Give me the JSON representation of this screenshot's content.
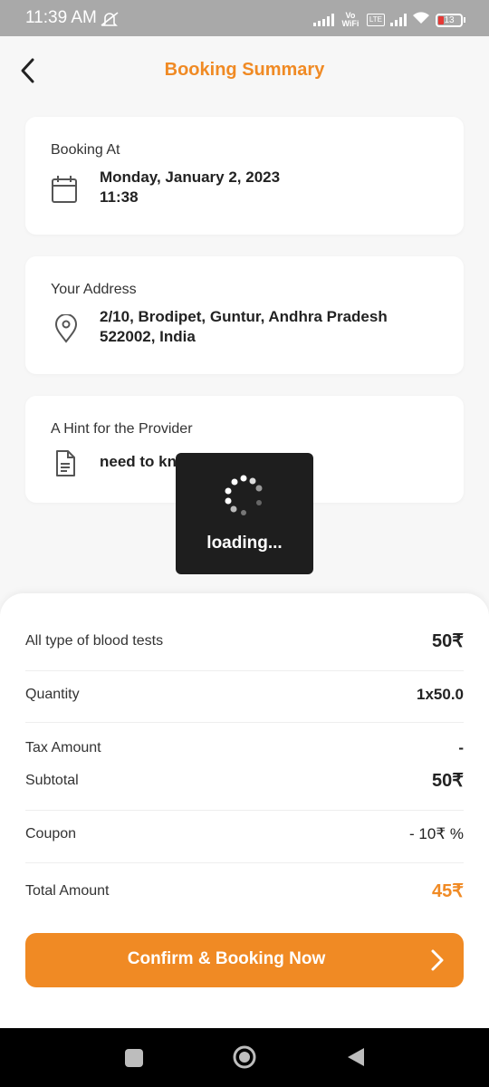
{
  "status_bar": {
    "time": "11:39 AM",
    "vo_wifi": "Vo WiFi",
    "volte": "Vo LTE",
    "battery": "13"
  },
  "header": {
    "title": "Booking Summary"
  },
  "booking": {
    "label": "Booking At",
    "date": "Monday, January 2, 2023",
    "time": "11:38"
  },
  "address": {
    "label": "Your Address",
    "line1": "2/10, Brodipet, Guntur, Andhra Pradesh",
    "line2": "522002, India"
  },
  "hint": {
    "label": "A Hint for the Provider",
    "text": "need to know blood group"
  },
  "loading": {
    "text": "loading..."
  },
  "summary": {
    "service_name": "All type of blood tests",
    "service_price": "50₹",
    "quantity_label": "Quantity",
    "quantity_value": "1x50.0",
    "tax_label": "Tax Amount",
    "tax_value": "-",
    "subtotal_label": "Subtotal",
    "subtotal_value": "50₹",
    "coupon_label": "Coupon",
    "coupon_value": "- 10₹ %",
    "total_label": "Total Amount",
    "total_value": "45₹"
  },
  "confirm_button": {
    "label": "Confirm & Booking Now"
  },
  "colors": {
    "accent": "#f08a24",
    "status_bar": "#a9a9a9"
  }
}
